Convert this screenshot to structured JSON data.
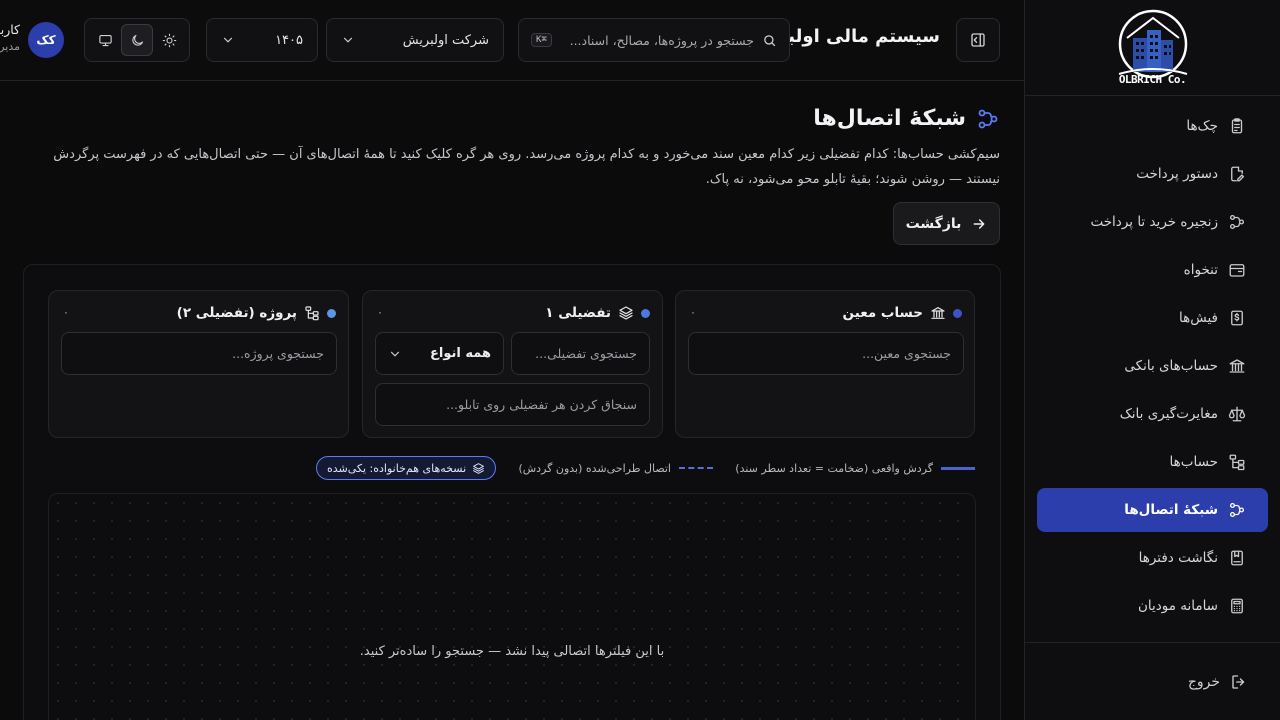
{
  "brand": {
    "logo_text": "OLBRICH Co."
  },
  "sidebar": {
    "items": [
      {
        "label": "چک‌ها",
        "icon": "clipboard-icon"
      },
      {
        "label": "دستور پرداخت",
        "icon": "file-edit-icon"
      },
      {
        "label": "زنجیره خرید تا پرداخت",
        "icon": "workflow-icon"
      },
      {
        "label": "تنخواه",
        "icon": "wallet-icon"
      },
      {
        "label": "فیش‌ها",
        "icon": "receipt-icon"
      },
      {
        "label": "حساب‌های بانکی",
        "icon": "bank-icon"
      },
      {
        "label": "مغایرت‌گیری بانک",
        "icon": "scale-icon"
      },
      {
        "label": "حساب‌ها",
        "icon": "tree-icon"
      },
      {
        "label": "شبکهٔ اتصال‌ها",
        "icon": "network-icon",
        "active": true
      },
      {
        "label": "نگاشت دفترها",
        "icon": "book-icon"
      },
      {
        "label": "سامانه مودیان",
        "icon": "calculator-icon"
      }
    ],
    "logout_label": "خروج"
  },
  "header": {
    "app_title": "سیستم مالی اولبریش",
    "search_placeholder": "جستجو در پروژه‌ها، مصالح، اسناد...",
    "search_shortcut": "K⌘",
    "company": "شرکت اولبریش",
    "year": "۱۴۰۵",
    "theme_modes": [
      "monitor-icon",
      "moon-icon",
      "sun-icon"
    ],
    "theme_active": "moon-icon",
    "user_initials": "کک",
    "user_name": "کاربر",
    "user_role": "مدیر"
  },
  "page": {
    "title": "شبکهٔ اتصال‌ها",
    "description": "سیم‌کشی حساب‌ها: کدام تفضیلی زیر کدام معین سند می‌خورد و به کدام پروژه می‌رسد. روی هر گره کلیک کنید تا همهٔ اتصال‌های آن — حتی اتصال‌هایی که در فهرست پرگردش نیستند — روشن شوند؛ بقیهٔ تابلو محو می‌شود، نه پاک.",
    "back_label": "بازگشت"
  },
  "columns": {
    "moein": {
      "title": "حساب معین",
      "count": "۰",
      "dot_color": "#3d54c9",
      "search_placeholder": "جستجوی معین..."
    },
    "tafsili": {
      "title": "تفضیلی ۱",
      "count": "۰",
      "dot_color": "#4a7ae0",
      "search_placeholder": "جستجوی تفضیلی...",
      "type_value": "همه انواع",
      "pin_placeholder": "سنجاق کردن هر تفضیلی روی تابلو..."
    },
    "project": {
      "title": "پروژه (تفضیلی ۲)",
      "count": "۰",
      "dot_color": "#5b96e6",
      "search_placeholder": "جستجوی پروژه..."
    }
  },
  "legend": {
    "actual": "گردش واقعی (ضخامت = تعداد سطر سند)",
    "designed": "اتصال طراحی‌شده (بدون گردش)",
    "family_badge": "نسخه‌های هم‌خانواده: یکی‌شده",
    "actual_color": "#4c63c9",
    "designed_color": "#5a6fd6"
  },
  "canvas": {
    "empty_message": "با این فیلترها اتصالی پیدا نشد — جستجو را ساده‌تر کنید."
  }
}
